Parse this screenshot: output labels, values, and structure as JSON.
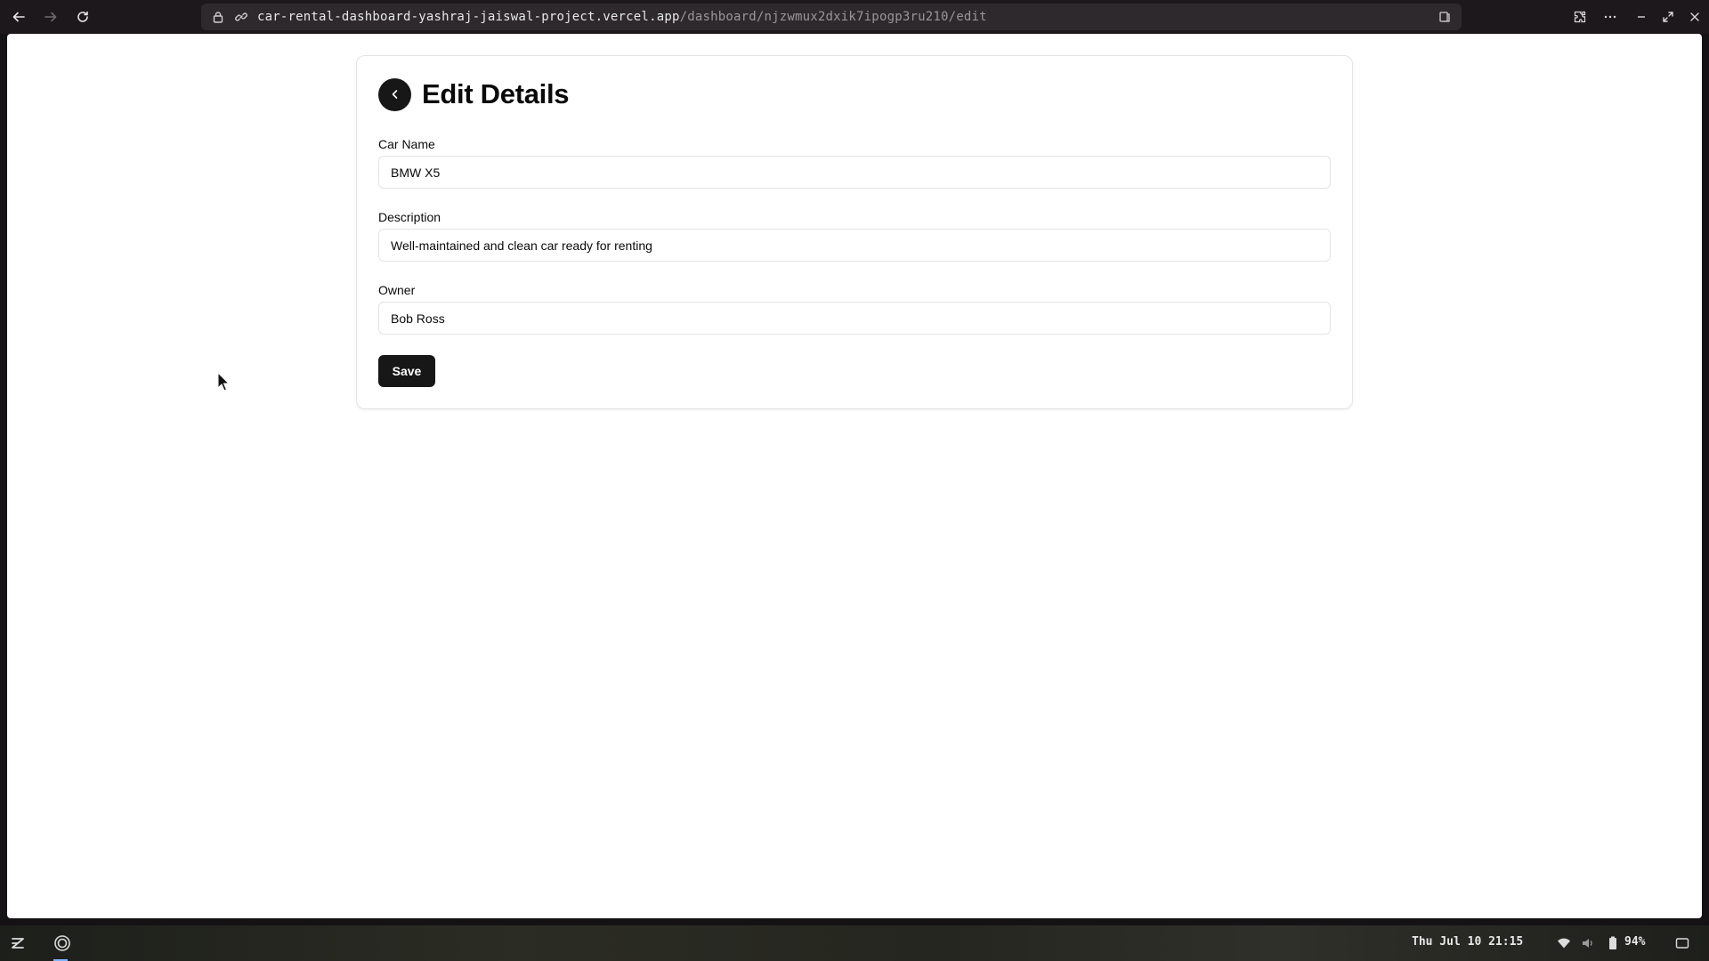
{
  "browser": {
    "url_host": "car-rental-dashboard-yashraj-jaiswal-project.vercel.app",
    "url_path": "/dashboard/njzwmux2dxik7ipogp3ru210/edit",
    "icons": [
      "back-arrow-icon",
      "forward-arrow-icon",
      "reload-icon",
      "lock-icon",
      "link-icon",
      "reader-mode-icon",
      "extensions-icon",
      "more-icon",
      "minimize-icon",
      "restore-icon",
      "close-icon"
    ]
  },
  "page": {
    "title": "Edit Details",
    "fields": {
      "car_name": {
        "label": "Car Name",
        "value": "BMW X5"
      },
      "description": {
        "label": "Description",
        "value": "Well-maintained and clean car ready for renting"
      },
      "owner": {
        "label": "Owner",
        "value": "Bob Ross"
      }
    },
    "save_label": "Save",
    "colors": {
      "primary_button": "#171717",
      "border": "#e4e4e7"
    }
  },
  "taskbar": {
    "datetime": "Thu Jul 10 21:15",
    "battery": "94%"
  }
}
